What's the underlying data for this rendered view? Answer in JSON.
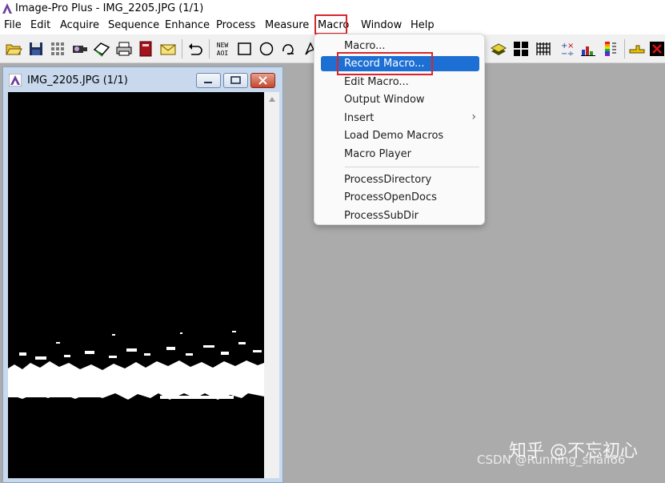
{
  "app": {
    "title": "Image-Pro Plus - IMG_2205.JPG (1/1)"
  },
  "menubar": {
    "items": [
      "File",
      "Edit",
      "Acquire",
      "Sequence",
      "Enhance",
      "Process",
      "Measure",
      "Macro",
      "Window",
      "Help"
    ]
  },
  "toolbar": {
    "icons": [
      "open-icon",
      "save-icon",
      "grid-icon",
      "camera-icon",
      "acquire-icon",
      "print-icon",
      "book-icon",
      "mail-icon",
      "undo-icon",
      "new-aoi-icon",
      "rectangle-icon",
      "ellipse-icon",
      "freehand-icon",
      "magic-wand-icon",
      "layers-icon",
      "quad-grid-icon",
      "hatch-icon",
      "math-icon",
      "histogram-icon",
      "color-bars-icon",
      "measure-icon",
      "close-icon"
    ],
    "new_aoi_label": "NEW AOI"
  },
  "image_window": {
    "title": "IMG_2205.JPG (1/1)"
  },
  "macro_menu": {
    "items": [
      {
        "label": "Macro..."
      },
      {
        "label": "Record Macro...",
        "highlighted": true
      },
      {
        "label": "Edit Macro..."
      },
      {
        "label": "Output Window"
      },
      {
        "label": "Insert",
        "submenu_arrow": "›"
      },
      {
        "label": "Load Demo Macros"
      },
      {
        "label": "Macro Player"
      },
      {
        "label": "ProcessDirectory"
      },
      {
        "label": "ProcessOpenDocs"
      },
      {
        "label": "ProcessSubDir"
      }
    ]
  },
  "watermark": {
    "line1": "知乎 @不忘初心",
    "line2": "CSDN @Running_snail66"
  },
  "colors": {
    "highlight": "#1e6fd3",
    "annotation_red": "#d9262b",
    "workspace": "#ababab"
  }
}
